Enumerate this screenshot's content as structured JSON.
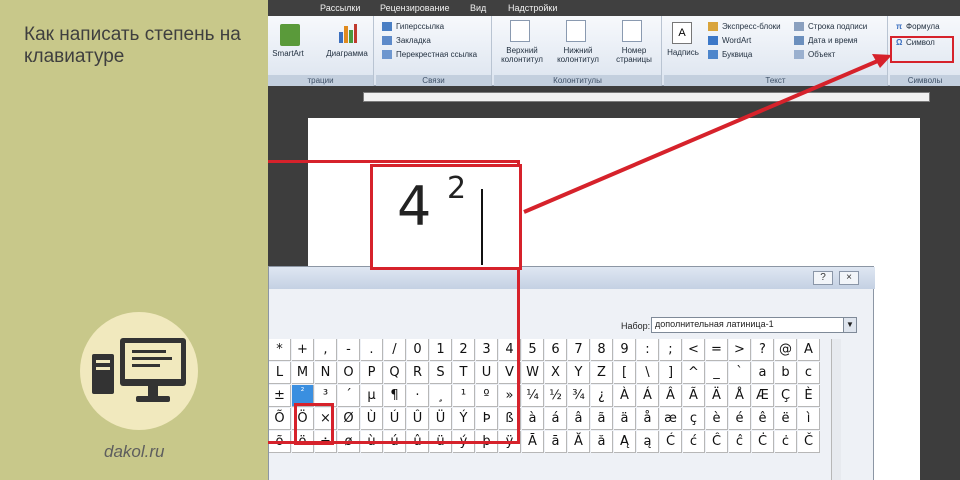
{
  "article": {
    "title": "Как написать степень на клавиатуре",
    "site": "dakol.ru"
  },
  "ribbon": {
    "menu": [
      "Рассылки",
      "Рецензирование",
      "Вид",
      "Надстройки"
    ],
    "groups": {
      "illustrations_label": "трации",
      "smartart": "SmartArt",
      "diagram": "Диаграмма",
      "links_label": "Связи",
      "hyperlink": "Гиперссылка",
      "bookmark": "Закладка",
      "crossref": "Перекрестная ссылка",
      "header": "Верхний колонтитул",
      "footer": "Нижний колонтитул",
      "pagenum": "Номер страницы",
      "hf_label": "Колонтитулы",
      "textbox": "Надпись",
      "express": "Экспресс-блоки",
      "wordart": "WordArt",
      "dropcap": "Буквица",
      "sigline": "Строка подписи",
      "datetime": "Дата и время",
      "object": "Объект",
      "text_label": "Текст",
      "formula": "Формула",
      "symbol": "Символ",
      "symbols_label": "Символы"
    }
  },
  "dialog": {
    "help": "?",
    "close": "×",
    "subset_label": "Набор:",
    "subset_value": "дополнительная латиница-1",
    "rows": [
      [
        "*",
        "+",
        ",",
        "-",
        ".",
        "/",
        "0",
        "1",
        "2",
        "3",
        "4",
        "5",
        "6",
        "7",
        "8",
        "9",
        ":",
        ";",
        "<",
        "=",
        ">",
        "?",
        "@",
        "A"
      ],
      [
        "L",
        "M",
        "N",
        "O",
        "P",
        "Q",
        "R",
        "S",
        "T",
        "U",
        "V",
        "W",
        "X",
        "Y",
        "Z",
        "[",
        "\\",
        "]",
        "^",
        "_",
        "`",
        "a",
        "b",
        "c"
      ],
      [
        "±",
        "²",
        "³",
        "´",
        "µ",
        "¶",
        "·",
        "¸",
        "¹",
        "º",
        "»",
        "¼",
        "½",
        "¾",
        "¿",
        "À",
        "Á",
        "Â",
        "Ã",
        "Ä",
        "Å",
        "Æ",
        "Ç",
        "È"
      ],
      [
        "Õ",
        "Ö",
        "×",
        "Ø",
        "Ù",
        "Ú",
        "Û",
        "Ü",
        "Ý",
        "Þ",
        "ß",
        "à",
        "á",
        "â",
        "ã",
        "ä",
        "å",
        "æ",
        "ç",
        "è",
        "é",
        "ê",
        "ë",
        "ì"
      ],
      [
        "õ",
        "ö",
        "÷",
        "ø",
        "ù",
        "ú",
        "û",
        "ü",
        "ý",
        "þ",
        "ÿ",
        "Ā",
        "ā",
        "Ă",
        "ă",
        "Ą",
        "ą",
        "Ć",
        "ć",
        "Ĉ",
        "ĉ",
        "Ċ",
        "ċ",
        "Č"
      ]
    ],
    "selected": "²"
  },
  "example": {
    "base": "4",
    "exponent": "2"
  },
  "colors": {
    "annotation_red": "#d6222b",
    "selection_blue": "#3a8fe0",
    "panel_green": "#c8c88a"
  }
}
